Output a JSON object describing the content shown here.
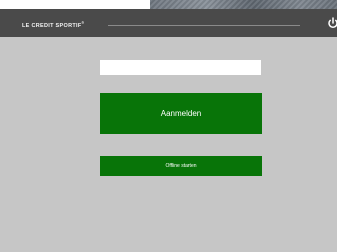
{
  "header": {
    "brand_name": "LE CREDIT SPORTIF",
    "brand_mark": "®",
    "power_icon": "power-icon"
  },
  "login": {
    "username_value": "",
    "login_label": "Aanmelden",
    "offline_label": "Offline starten"
  },
  "colors": {
    "title_bar": "#4a4a4a",
    "body_background": "#c6c6c6",
    "button_green": "#087408",
    "button_text": "#ffffff"
  }
}
